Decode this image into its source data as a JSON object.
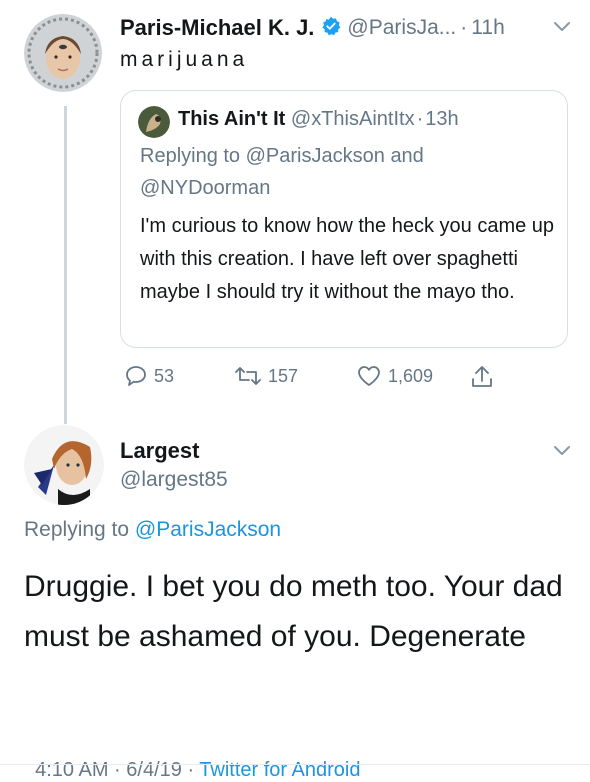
{
  "tweet1": {
    "display_name": "Paris-Michael K. J.",
    "handle": "@ParisJa...",
    "separator": "·",
    "time": "11h",
    "text": "marijuana",
    "quoted": {
      "display_name": "This Ain't It",
      "handle": "@xThisAintItx",
      "time_sep": "·",
      "time": "13h",
      "replying_prefix": "Replying to",
      "reply_user1": "@ParisJackson",
      "reply_and": "and",
      "reply_user2": "@NYDoorman",
      "text": "I'm curious to know how the heck you came up with this creation. I have left over spaghetti maybe I should try it without the mayo tho."
    },
    "actions": {
      "reply_count": "53",
      "retweet_count": "157",
      "like_count": "1,609"
    }
  },
  "tweet2": {
    "display_name": "Largest",
    "handle": "@largest85",
    "replying_prefix": "Replying to",
    "reply_user": "@ParisJackson",
    "text": "Druggie. I bet you do meth too. Your dad must be ashamed of you. Degenerate",
    "timestamp": "4:10 AM · 6/4/19 · ",
    "source": "Twitter for Android"
  },
  "colors": {
    "muted": "#657786",
    "link": "#1b95e0",
    "verified": "#1da1f2",
    "border": "#d6dfe6"
  },
  "icons": [
    "verified-badge-icon",
    "chevron-down-icon",
    "reply-icon",
    "retweet-icon",
    "like-icon",
    "share-icon"
  ]
}
